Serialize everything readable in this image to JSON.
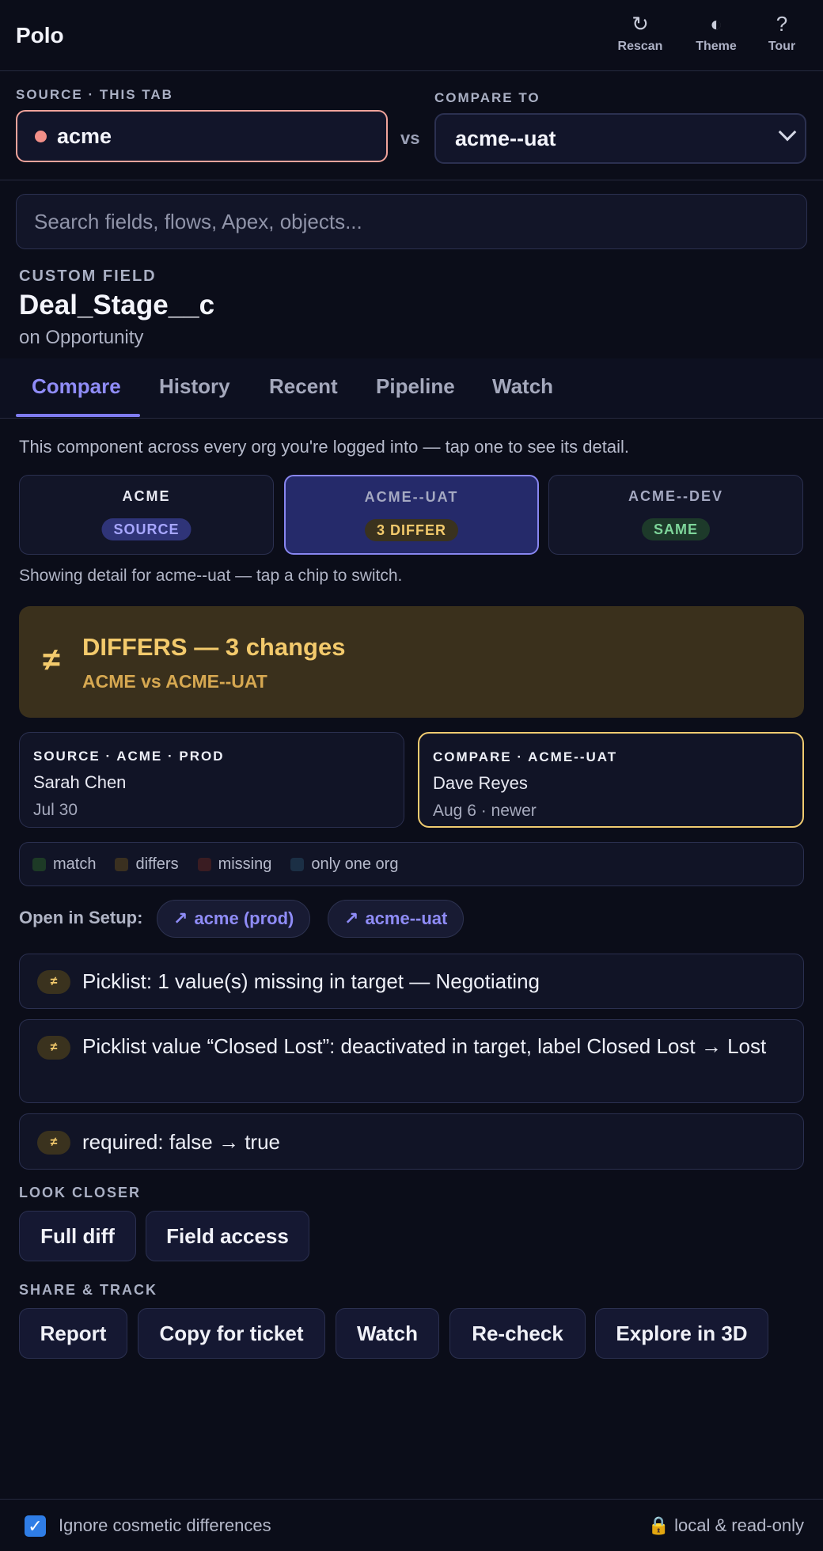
{
  "app": {
    "brand": "Polo",
    "actions": [
      {
        "label": "Rescan",
        "icon": "refresh-icon",
        "glyph": "↻"
      },
      {
        "label": "Theme",
        "icon": "contrast-icon",
        "glyph": "◐"
      },
      {
        "label": "Tour",
        "icon": "help-icon",
        "glyph": "?"
      }
    ]
  },
  "env": {
    "source_label": "SOURCE · THIS TAB",
    "source_value": "acme",
    "vs": "vs",
    "compare_label": "COMPARE TO",
    "compare_value": "acme--uat"
  },
  "search": {
    "placeholder": "Search fields, flows, Apex, objects..."
  },
  "component": {
    "type": "CUSTOM FIELD",
    "name": "Deal_Stage__c",
    "object": "on Opportunity"
  },
  "tabs": [
    "Compare",
    "History",
    "Recent",
    "Pipeline",
    "Watch"
  ],
  "compare": {
    "intro": "This component across every org you're logged into — tap one to see its detail.",
    "chips": [
      {
        "name": "ACME",
        "badge": "SOURCE"
      },
      {
        "name": "ACME--UAT",
        "badge": "3 DIFFER"
      },
      {
        "name": "ACME--DEV",
        "badge": "SAME"
      }
    ],
    "showing": "Showing detail for acme--uat — tap a chip to switch.",
    "banner": {
      "icon": "≠",
      "title": "DIFFERS — 3 changes",
      "subtitle": "ACME vs ACME--UAT"
    },
    "source_card": {
      "header": "SOURCE · ACME · PROD",
      "author": "Sarah Chen",
      "date": "Jul 30"
    },
    "compare_card": {
      "header": "COMPARE · ACME--UAT",
      "author": "Dave Reyes",
      "date": "Aug 6 · newer"
    },
    "legend": [
      {
        "label": "match",
        "color": "#1d3a26"
      },
      {
        "label": "differs",
        "color": "#3a3020"
      },
      {
        "label": "missing",
        "color": "#3a1c22"
      },
      {
        "label": "only one org",
        "color": "#1b2f45"
      }
    ],
    "setup_label": "Open in Setup:",
    "setup_links": [
      "acme (prod)",
      "acme--uat"
    ],
    "diffs": [
      "Picklist: 1 value(s) missing in target — Negotiating",
      "Picklist value “Closed Lost”: deactivated in target, label Closed Lost → Lost",
      "required: false → true"
    ],
    "diff_icon": "≠",
    "look_closer_label": "LOOK CLOSER",
    "look_closer": [
      "Full diff",
      "Field access"
    ],
    "share_label": "SHARE & TRACK",
    "share": [
      "Report",
      "Copy for ticket",
      "Watch",
      "Re-check",
      "Explore in 3D"
    ]
  },
  "footer": {
    "ignore_label": "Ignore cosmetic differences",
    "ignore_checked": true,
    "readonly": "local & read-only"
  }
}
